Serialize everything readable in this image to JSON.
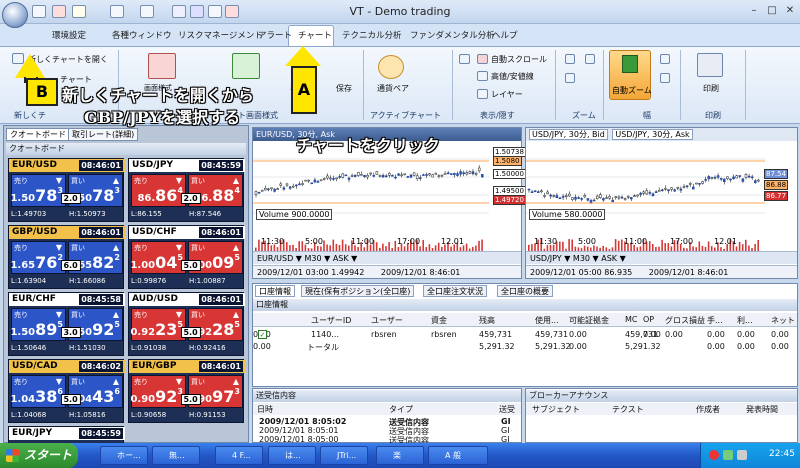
{
  "window": {
    "title": "VT - Demo trading"
  },
  "menu_tabs": [
    "環境設定",
    "各種ウィンドウ",
    "リスクマネージメント",
    "アラート",
    "チャート",
    "テクニカル分析",
    "ファンダメンタル分析",
    "ヘルプ"
  ],
  "ribbon": {
    "new_chart": "新しくチャートを開く",
    "chart_sub": "チャート",
    "new_group": "新しくチ",
    "image_format": "画面様式",
    "print": "印刷",
    "print_group": "印刷",
    "save_prefix": "名",
    "save": "保存",
    "chart_group": "ト画面様式",
    "currency_pair": "通貨ペア",
    "active_chart": "アクティブチャート",
    "auto_scroll": "自動スクロール",
    "hl_line": "高値/安値線",
    "layer": "レイヤー",
    "display_group": "表示/隠す",
    "zoom": "ズーム",
    "auto_zoom": "自動ズーム",
    "width": "幅"
  },
  "annotations": {
    "callout_a": "A",
    "callout_b": "B",
    "text_b_line1": "新しくチャートを開くから",
    "text_b_line2": "GBP/JPYを選択する",
    "text_a": "チャートをクリック"
  },
  "quote_panel": {
    "tab1": "クオートボード",
    "tab2": "取引レート(詳細)",
    "header": "クオートボード",
    "sell": "売り",
    "buy": "買い",
    "cards": [
      {
        "pair": "EUR/USD",
        "time": "08:46:01",
        "bid_pre": "1.50",
        "bid_big": "78",
        "bid_sup": "3",
        "ask_pre": "1.50",
        "ask_big": "78",
        "ask_sup": "3",
        "spread": "2.0",
        "low": "L:1.49703",
        "high": "H:1.50973",
        "color": "blue",
        "hdr": "#f2c14a"
      },
      {
        "pair": "USD/JPY",
        "time": "08:45:59",
        "bid_pre": "86.",
        "bid_big": "86",
        "bid_sup": "4",
        "ask_pre": "86.",
        "ask_big": "88",
        "ask_sup": "4",
        "spread": "2.0",
        "low": "L:86.155",
        "high": "H:87.546",
        "color": "red",
        "hdr": "#ffffff"
      },
      {
        "pair": "GBP/USD",
        "time": "08:46:01",
        "bid_pre": "1.65",
        "bid_big": "76",
        "bid_sup": "2",
        "ask_pre": "1.65",
        "ask_big": "82",
        "ask_sup": "2",
        "spread": "6.0",
        "low": "L:1.63904",
        "high": "H:1.66086",
        "color": "blue",
        "hdr": "#f2c14a"
      },
      {
        "pair": "USD/CHF",
        "time": "08:46:01",
        "bid_pre": "1.00",
        "bid_big": "04",
        "bid_sup": "5",
        "ask_pre": "1.00",
        "ask_big": "09",
        "ask_sup": "5",
        "spread": "5.0",
        "low": "L:0.99876",
        "high": "H:1.00887",
        "color": "red",
        "hdr": "#ffffff"
      },
      {
        "pair": "EUR/CHF",
        "time": "08:45:58",
        "bid_pre": "1.50",
        "bid_big": "89",
        "bid_sup": "5",
        "ask_pre": "1.50",
        "ask_big": "92",
        "ask_sup": "5",
        "spread": "3.0",
        "low": "L:1.50646",
        "high": "H:1.51030",
        "color": "blue",
        "hdr": "#ffffff"
      },
      {
        "pair": "AUD/USD",
        "time": "08:46:01",
        "bid_pre": "0.92",
        "bid_big": "23",
        "bid_sup": "5",
        "ask_pre": "0.92",
        "ask_big": "28",
        "ask_sup": "5",
        "spread": "5.0",
        "low": "L:0.91038",
        "high": "H:0.92416",
        "color": "red",
        "hdr": "#ffffff"
      },
      {
        "pair": "USD/CAD",
        "time": "08:46:02",
        "bid_pre": "1.04",
        "bid_big": "38",
        "bid_sup": "6",
        "ask_pre": "1.04",
        "ask_big": "43",
        "ask_sup": "6",
        "spread": "5.0",
        "low": "L:1.04068",
        "high": "H:1.05816",
        "color": "blue",
        "hdr": "#f2c14a"
      },
      {
        "pair": "EUR/GBP",
        "time": "08:46:01",
        "bid_pre": "0.90",
        "bid_big": "92",
        "bid_sup": "3",
        "ask_pre": "0.90",
        "ask_big": "97",
        "ask_sup": "3",
        "spread": "5.0",
        "low": "L:0.90658",
        "high": "H:0.91153",
        "color": "red",
        "hdr": "#f2c14a"
      },
      {
        "pair": "EUR/JPY",
        "time": "08:45:59",
        "color": "blue",
        "hdr": "#ffffff"
      }
    ]
  },
  "chart1": {
    "title": "EUR/USD, 30分, Ask",
    "volume_label": "Volume",
    "volume_value": "900.0000",
    "ticks": [
      "11:30",
      "5:00",
      "11:00",
      "17:00",
      "12.01"
    ],
    "prices": [
      "1.50738",
      "1.5080",
      "1.50000",
      "1.49500",
      "1.49720"
    ],
    "toolbar": "EUR/USD ▼ M30 ▼ ASK ▼",
    "status_left": "2009/12/01 03:00  1.49942",
    "status_right": "2009/12/01 8:46:01"
  },
  "chart2": {
    "tab1": "USD/JPY, 30分, Bid",
    "tab2": "USD/JPY, 30分, Ask",
    "volume_label": "Volume",
    "volume_value": "580.0000",
    "ticks": [
      "11:30",
      "5:00",
      "11:00",
      "17:00",
      "12.01"
    ],
    "prices": [
      "87.54",
      "86.88",
      "86.77"
    ],
    "toolbar": "USD/JPY ▼ M30 ▼ ASK ▼",
    "status_left": "2009/12/01 05:00  86.935",
    "status_right": "2009/12/01 8:46:01"
  },
  "account": {
    "tabs": [
      "口座情報",
      "現在(保有ポジション(全口座)",
      "全口座注文状況",
      "全口座の概要"
    ],
    "header": "口座情報",
    "columns": [
      "",
      "ユーザーID",
      "ユーザー",
      "資金",
      "残高",
      "使用...",
      "可能証拠金",
      "MC",
      "OP",
      "グロス損益",
      "手...",
      "利...",
      "ネット"
    ],
    "rows": [
      [
        "1140...",
        "rbsren",
        "rbsren",
        "459,731",
        "459,731",
        "0.00",
        "459,731",
        "0.00",
        "0.00",
        "0.00",
        "0.00",
        "0.00",
        "0.00"
      ],
      [
        "トータル",
        "",
        "",
        "5,291.32",
        "5,291.32",
        "0.00",
        "5,291.32",
        "",
        "",
        "0.00",
        "0.00",
        "0.00",
        "0.00"
      ]
    ]
  },
  "sent_panel": {
    "title": "送受信内容",
    "col_time": "日時",
    "col_type": "タイプ",
    "col_send": "送受",
    "rows": [
      {
        "time": "2009/12/01 8:05:02",
        "type": "送受信内容",
        "send": "GI"
      },
      {
        "time": "2009/12/01 8:05:01",
        "type": "送受信内容",
        "send": "GI"
      },
      {
        "time": "2009/12/01 8:05:00",
        "type": "送受信内容",
        "send": "GI"
      }
    ]
  },
  "broker_panel": {
    "title": "ブローカーアナウンス",
    "cols": [
      "サブジェクト",
      "テクスト",
      "作成者",
      "発表時間"
    ]
  },
  "taskbar": {
    "start": "スタート",
    "tasks": [
      "ホー...",
      "無...",
      "4 F...",
      "は...",
      "JTri...",
      "楽",
      "A 般"
    ],
    "clock": "22:45"
  }
}
